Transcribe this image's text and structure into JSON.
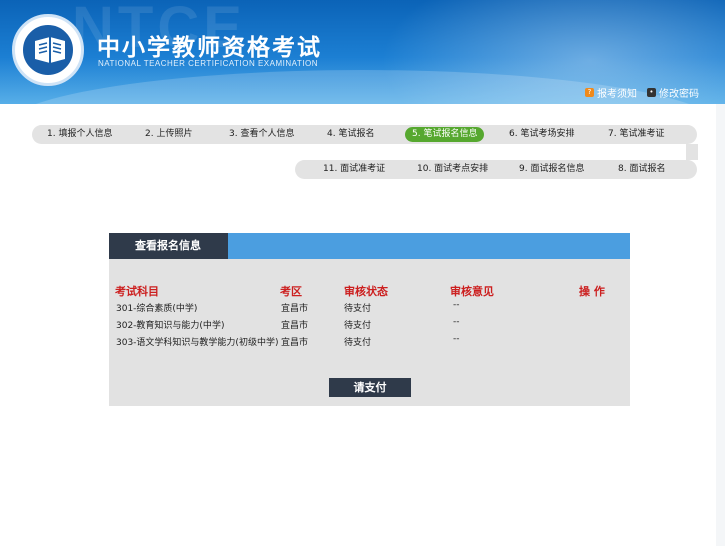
{
  "header": {
    "title_cn": "中小学教师资格考试",
    "title_en": "NATIONAL TEACHER CERTIFICATION EXAMINATION",
    "links": [
      {
        "label": "报考须知",
        "icon": "help-icon"
      },
      {
        "label": "修改密码",
        "icon": "password-icon"
      }
    ]
  },
  "steps_row1": [
    {
      "label": "1. 填报个人信息",
      "active": false
    },
    {
      "label": "2. 上传照片",
      "active": false
    },
    {
      "label": "3. 查看个人信息",
      "active": false
    },
    {
      "label": "4. 笔试报名",
      "active": false
    },
    {
      "label": "5. 笔试报名信息",
      "active": true
    },
    {
      "label": "6. 笔试考场安排",
      "active": false
    },
    {
      "label": "7. 笔试准考证",
      "active": false
    }
  ],
  "steps_row2": [
    {
      "label": "11. 面试准考证",
      "active": false
    },
    {
      "label": "10. 面试考点安排",
      "active": false
    },
    {
      "label": "9. 面试报名信息",
      "active": false
    },
    {
      "label": "8. 面试报名",
      "active": false
    }
  ],
  "colors": {
    "accent_green": "#56a82f",
    "panel_blue": "#4b9ee0",
    "dark": "#2f3a4a",
    "header_red": "#cc1f1f"
  },
  "panel": {
    "title": "查看报名信息",
    "columns": [
      "考试科目",
      "考区",
      "审核状态",
      "审核意见",
      "操  作"
    ],
    "rows": [
      [
        "301-综合素质(中学)",
        "宜昌市",
        "待支付",
        "--",
        ""
      ],
      [
        "302-教育知识与能力(中学)",
        "宜昌市",
        "待支付",
        "--",
        ""
      ],
      [
        "303-语文学科知识与教学能力(初级中学)",
        "宜昌市",
        "待支付",
        "--",
        ""
      ]
    ],
    "pay_button": "请支付"
  }
}
